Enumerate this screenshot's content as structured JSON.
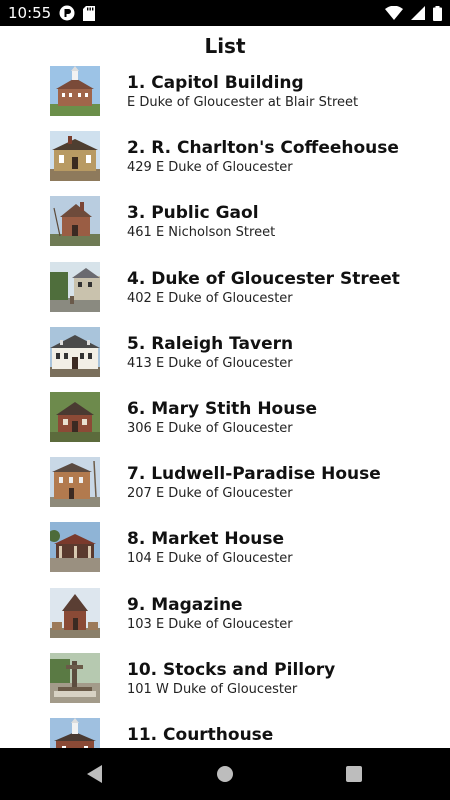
{
  "status_bar": {
    "time": "10:55",
    "icons": [
      "app-notification-icon",
      "sd-card-icon",
      "wifi-icon",
      "cellular-icon",
      "battery-icon"
    ]
  },
  "header": {
    "title": "List"
  },
  "list": {
    "items": [
      {
        "title": "1. Capitol Building",
        "address": "E Duke of Gloucester at Blair Street",
        "thumb": "capitol-building-photo"
      },
      {
        "title": "2. R. Charlton's Coffeehouse",
        "address": "429 E Duke of Gloucester",
        "thumb": "coffeehouse-photo"
      },
      {
        "title": "3. Public Gaol",
        "address": "461 E Nicholson Street",
        "thumb": "public-gaol-photo"
      },
      {
        "title": "4. Duke of Gloucester Street",
        "address": "402 E Duke of Gloucester",
        "thumb": "street-photo"
      },
      {
        "title": "5. Raleigh Tavern",
        "address": "413 E Duke of Gloucester",
        "thumb": "raleigh-tavern-photo"
      },
      {
        "title": "6. Mary Stith House",
        "address": "306 E Duke of Gloucester",
        "thumb": "mary-stith-house-photo"
      },
      {
        "title": "7. Ludwell-Paradise House",
        "address": "207 E Duke of Gloucester",
        "thumb": "ludwell-paradise-house-photo"
      },
      {
        "title": "8. Market House",
        "address": "104 E Duke of Gloucester",
        "thumb": "market-house-photo"
      },
      {
        "title": "9. Magazine",
        "address": "103 E Duke of Gloucester",
        "thumb": "magazine-photo"
      },
      {
        "title": "10. Stocks and Pillory",
        "address": "101 W Duke of Gloucester",
        "thumb": "stocks-and-pillory-photo"
      },
      {
        "title": "11. Courthouse",
        "address": "",
        "thumb": "courthouse-photo"
      }
    ]
  },
  "nav_bar": {
    "buttons": [
      "back-icon",
      "home-icon",
      "recents-icon"
    ]
  }
}
